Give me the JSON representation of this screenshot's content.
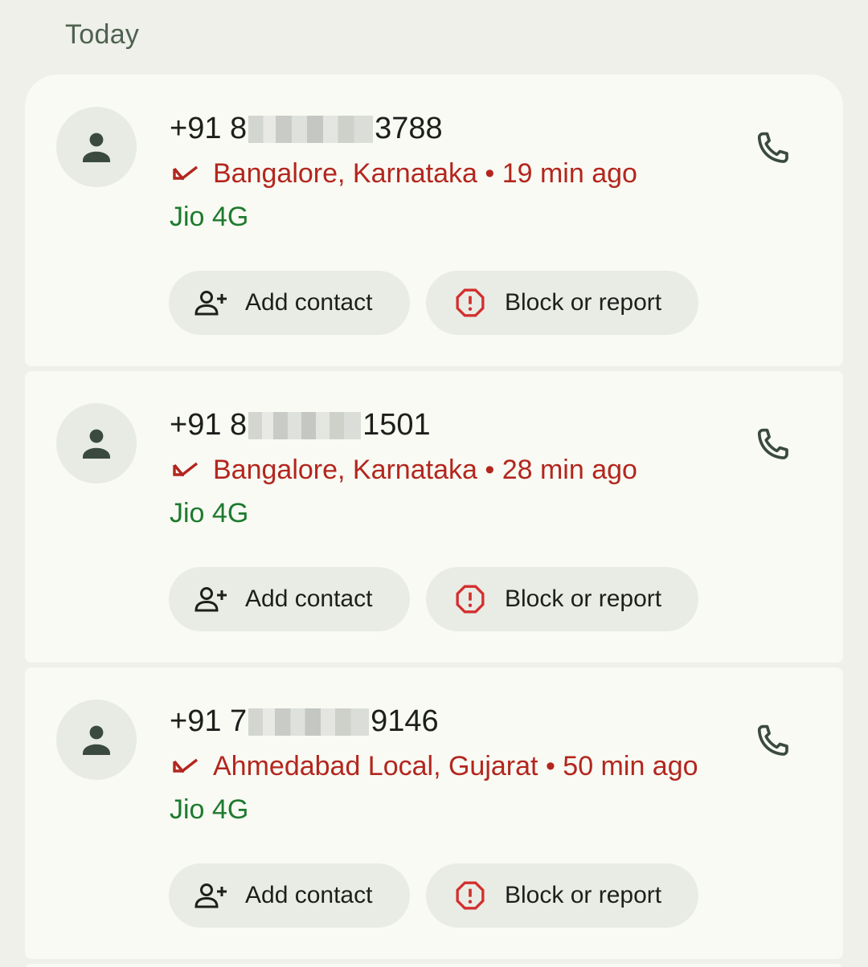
{
  "section": {
    "title": "Today"
  },
  "calls": [
    {
      "number_prefix": "+91 8",
      "number_suffix": "3788",
      "location": "Bangalore, Karnataka",
      "separator": "•",
      "time": "19 min ago",
      "carrier": "Jio 4G",
      "add_label": "Add contact",
      "block_label": "Block or report"
    },
    {
      "number_prefix": "+91 8",
      "number_suffix": "1501",
      "location": "Bangalore, Karnataka",
      "separator": "•",
      "time": "28 min ago",
      "carrier": "Jio 4G",
      "add_label": "Add contact",
      "block_label": "Block or report"
    },
    {
      "number_prefix": "+91 7",
      "number_suffix": "9146",
      "location": "Ahmedabad Local, Gujarat",
      "separator": "•",
      "time": "50 min ago",
      "carrier": "Jio 4G",
      "add_label": "Add contact",
      "block_label": "Block or report"
    }
  ],
  "icons": {
    "avatar": "person-icon",
    "missed": "missed-call-icon",
    "call": "phone-icon",
    "add": "person-add-icon",
    "block": "report-octagon-icon"
  },
  "colors": {
    "background": "#eef0e9",
    "card": "#f8faf3",
    "missed": "#b3261e",
    "carrier": "#1e7a2f",
    "icon": "#3b4a3e"
  }
}
